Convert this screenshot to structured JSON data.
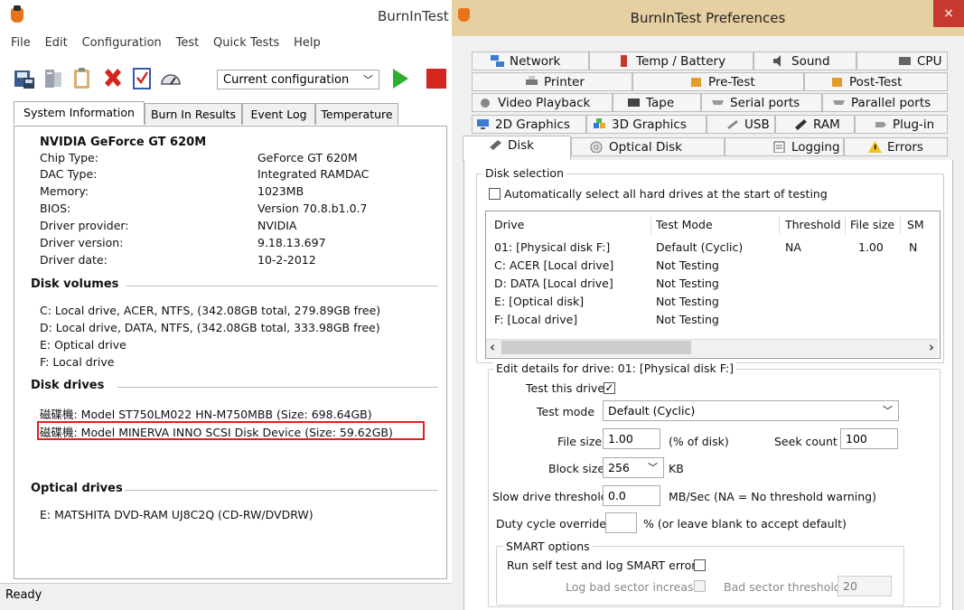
{
  "main": {
    "title": "BurnInTest",
    "menu": [
      "File",
      "Edit",
      "Configuration",
      "Test",
      "Quick Tests",
      "Help"
    ],
    "config_select": "Current configuration",
    "tabs": [
      "System Information",
      "Burn In Results",
      "Event Log",
      "Temperature"
    ],
    "gpu": {
      "name": "NVIDIA GeForce GT 620M",
      "rows": [
        {
          "label": "Chip Type:",
          "value": "GeForce GT 620M"
        },
        {
          "label": "DAC Type:",
          "value": "Integrated RAMDAC"
        },
        {
          "label": "Memory:",
          "value": "1023MB"
        },
        {
          "label": "BIOS:",
          "value": "Version 70.8.b1.0.7"
        },
        {
          "label": "Driver provider:",
          "value": "NVIDIA"
        },
        {
          "label": "Driver version:",
          "value": "9.18.13.697"
        },
        {
          "label": "Driver date:",
          "value": "10-2-2012"
        }
      ]
    },
    "disk_volumes": {
      "title": "Disk volumes",
      "items": [
        "C: Local drive, ACER, NTFS, (342.08GB total, 279.89GB free)",
        "D: Local drive, DATA, NTFS, (342.08GB total, 333.98GB free)",
        "E: Optical drive",
        "F: Local drive"
      ]
    },
    "disk_drives": {
      "title": "Disk drives",
      "items": [
        "磁碟機: Model ST750LM022 HN-M750MBB (Size: 698.64GB)",
        "磁碟機: Model MINERVA INNO SCSI Disk Device (Size: 59.62GB)"
      ]
    },
    "optical_drives": {
      "title": "Optical drives",
      "items": [
        "E: MATSHITA DVD-RAM UJ8C2Q (CD-RW/DVDRW)"
      ]
    },
    "status": "Ready",
    "highlight_color": "#e3201b"
  },
  "prefs": {
    "title": "BurnInTest Preferences",
    "close": "×",
    "tabs": {
      "row1": [
        {
          "label": "Network",
          "icon": "network-icon"
        },
        {
          "label": "Temp / Battery",
          "icon": "battery-icon"
        },
        {
          "label": "Sound",
          "icon": "speaker-icon"
        },
        {
          "label": "CPU",
          "icon": "cpu-icon"
        }
      ],
      "row2": [
        {
          "label": "Printer",
          "icon": "printer-icon"
        },
        {
          "label": "Pre-Test",
          "icon": "pretest-icon"
        },
        {
          "label": "Post-Test",
          "icon": "posttest-icon"
        }
      ],
      "row3": [
        {
          "label": "Video Playback",
          "icon": "video-icon"
        },
        {
          "label": "Tape",
          "icon": "tape-icon"
        },
        {
          "label": "Serial ports",
          "icon": "serial-icon"
        },
        {
          "label": "Parallel ports",
          "icon": "parallel-icon"
        }
      ],
      "row4": [
        {
          "label": "2D Graphics",
          "icon": "monitor-icon"
        },
        {
          "label": "3D Graphics",
          "icon": "cubes-icon"
        },
        {
          "label": "USB",
          "icon": "usb-icon"
        },
        {
          "label": "RAM",
          "icon": "ram-icon"
        },
        {
          "label": "Plug-in",
          "icon": "plugin-icon"
        }
      ],
      "row5": [
        {
          "label": "Disk",
          "icon": "disk-icon"
        },
        {
          "label": "Optical Disk",
          "icon": "optical-icon"
        },
        {
          "label": "Logging",
          "icon": "logging-icon"
        },
        {
          "label": "Errors",
          "icon": "warning-icon"
        }
      ]
    },
    "disk_selection": {
      "title": "Disk selection",
      "auto_select": "Automatically select all hard drives at the start of testing",
      "columns": [
        "Drive",
        "Test Mode",
        "Threshold",
        "File size",
        "SM"
      ],
      "rows": [
        {
          "drive": "01:  [Physical disk F:]",
          "mode": "Default (Cyclic)",
          "threshold": "NA",
          "filesize": "1.00",
          "sm": "N"
        },
        {
          "drive": "C:  ACER [Local drive]",
          "mode": "Not Testing",
          "threshold": "",
          "filesize": "",
          "sm": ""
        },
        {
          "drive": "D:  DATA [Local drive]",
          "mode": "Not Testing",
          "threshold": "",
          "filesize": "",
          "sm": ""
        },
        {
          "drive": "E:  [Optical disk]",
          "mode": "Not Testing",
          "threshold": "",
          "filesize": "",
          "sm": ""
        },
        {
          "drive": "F:  [Local drive]",
          "mode": "Not Testing",
          "threshold": "",
          "filesize": "",
          "sm": ""
        }
      ],
      "scroll_left": "‹",
      "scroll_right": "›"
    },
    "edit": {
      "title": "Edit details for drive: 01:  [Physical disk F:]",
      "test_this_drive": "Test this drive",
      "test_this_drive_checked": "✓",
      "test_mode_label": "Test mode",
      "test_mode_value": "Default (Cyclic)",
      "file_size_label": "File size",
      "file_size_value": "1.00",
      "file_size_unit": "(% of disk)",
      "seek_count_label": "Seek count",
      "seek_count_value": "100",
      "block_size_label": "Block size",
      "block_size_value": "256",
      "block_size_unit": "KB",
      "slow_label": "Slow drive threshold",
      "slow_value": "0.0",
      "slow_unit": "MB/Sec  (NA = No threshold warning)",
      "duty_label": "Duty cycle override",
      "duty_value": "",
      "duty_unit": "% (or leave blank to accept default)",
      "smart_title": "SMART options",
      "smart_run": "Run self test and log SMART errors",
      "bad_sector_inc": "Log bad sector increase",
      "bad_sector_thr_label": "Bad sector threshold",
      "bad_sector_thr_value": "20"
    }
  }
}
